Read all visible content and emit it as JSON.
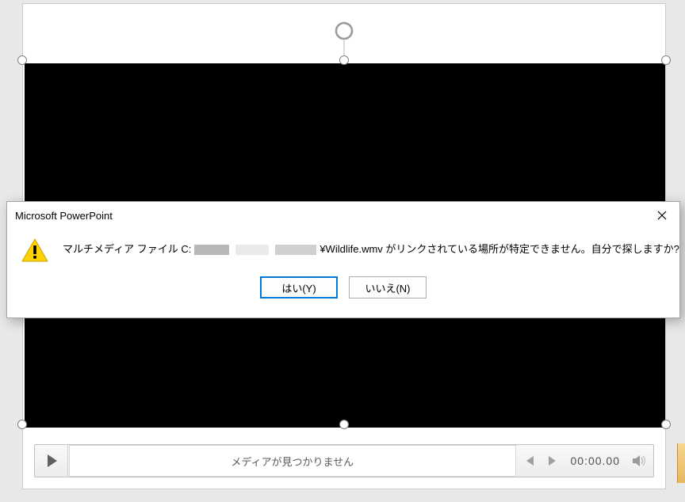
{
  "dialog": {
    "title": "Microsoft PowerPoint",
    "message_prefix": "マルチメディア ファイル C:",
    "message_filename": "¥Wildlife.wmv",
    "message_suffix": " がリンクされている場所が特定できません。自分で探しますか?",
    "yes_label": "はい(Y)",
    "no_label": "いいえ(N)"
  },
  "media": {
    "track_message": "メディアが見つかりません",
    "time": "00:00.00"
  }
}
